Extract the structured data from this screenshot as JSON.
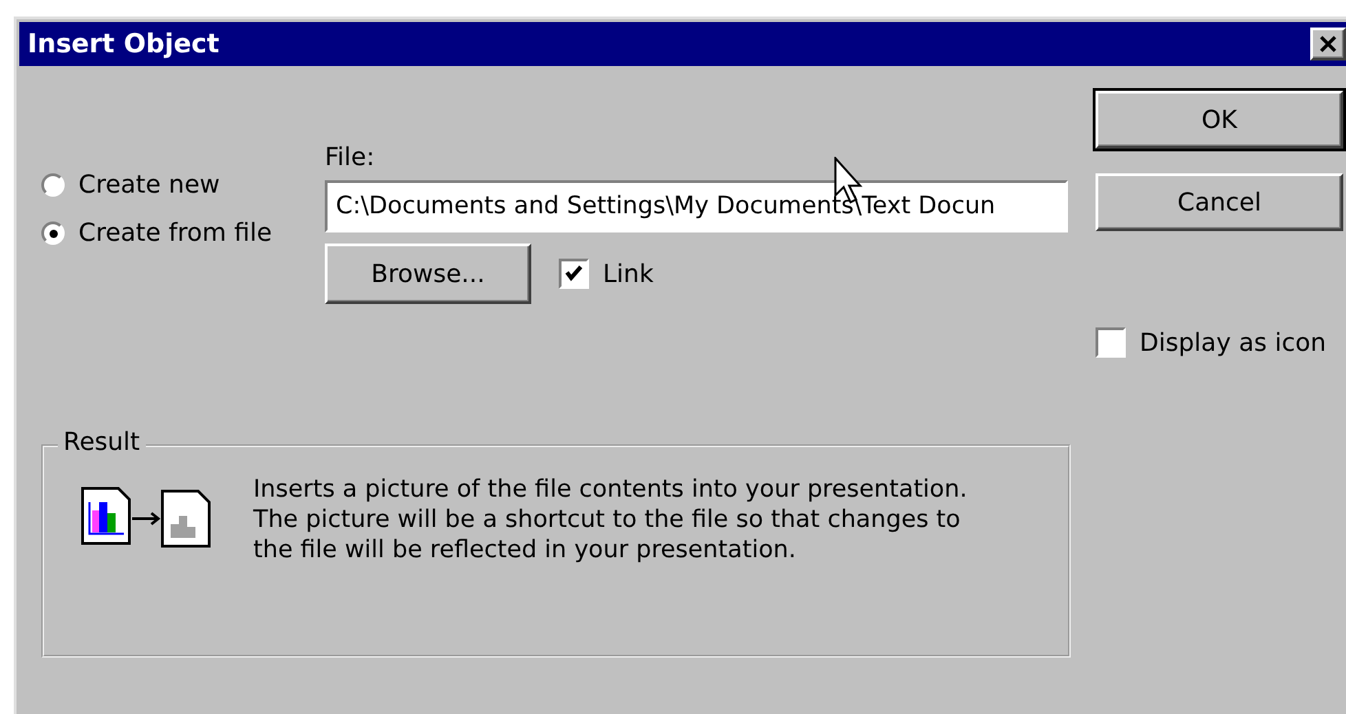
{
  "window": {
    "title": "Insert Object"
  },
  "source_options": [
    {
      "label": "Create new",
      "selected": false
    },
    {
      "label": "Create from file",
      "selected": true
    }
  ],
  "file": {
    "label": "File:",
    "value": "C:\\Documents and Settings\\My Documents\\Text Docun"
  },
  "browse_button": "Browse...",
  "link": {
    "label": "Link",
    "checked": true
  },
  "buttons": [
    {
      "label": "OK",
      "default": true
    },
    {
      "label": "Cancel",
      "default": false
    }
  ],
  "display_as_icon": {
    "label": "Display as icon",
    "checked": false
  },
  "result": {
    "title": "Result",
    "text": "Inserts a picture of the file contents into your presentation. The picture will be a shortcut to the file so that changes to the file will be reflected in your presentation."
  }
}
